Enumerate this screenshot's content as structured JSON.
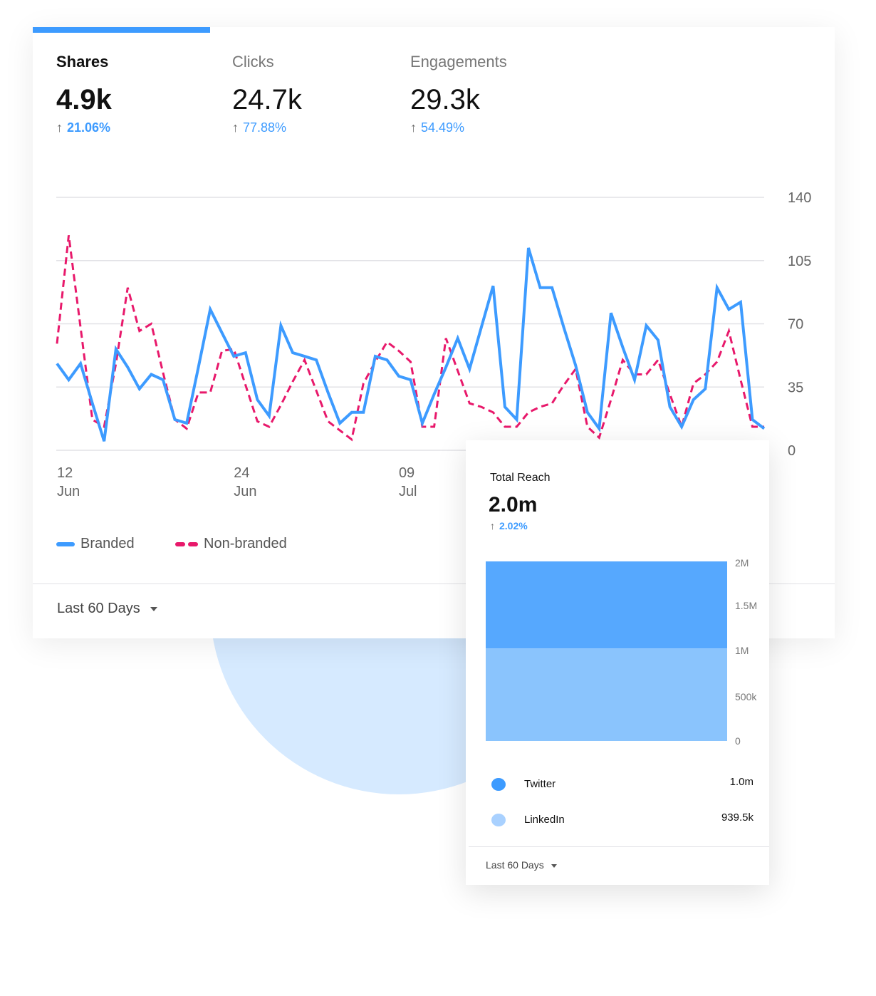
{
  "colors": {
    "accent": "#3d9bff",
    "branded": "#3d9bff",
    "non_branded": "#e8196b",
    "twitter": "#3d9bff",
    "linkedin": "#a9d1ff",
    "grid": "#e2e2e6",
    "background_circle": "#d6eaff"
  },
  "tabs": [
    {
      "label": "Shares",
      "value": "4.9k",
      "change": "21.06%",
      "active": true,
      "icon": "arrow-up-icon"
    },
    {
      "label": "Clicks",
      "value": "24.7k",
      "change": "77.88%",
      "active": false,
      "icon": "arrow-up-icon"
    },
    {
      "label": "Engagements",
      "value": "29.3k",
      "change": "54.49%",
      "active": false,
      "icon": "arrow-up-icon"
    }
  ],
  "arrow_glyph": "↑",
  "legend": {
    "branded": "Branded",
    "non_branded": "Non-branded"
  },
  "footer": {
    "range": "Last 60 Days"
  },
  "popup": {
    "title": "Total Reach",
    "value": "2.0m",
    "change": "2.02%",
    "items": [
      {
        "name": "Twitter",
        "value": "1.0m"
      },
      {
        "name": "LinkedIn",
        "value": "939.5k"
      }
    ],
    "footer": "Last 60 Days"
  },
  "chart_data": [
    {
      "type": "line",
      "ylim": [
        0,
        140
      ],
      "yticks": [
        "0",
        "35",
        "70",
        "105",
        "140"
      ],
      "ytick_values": [
        0,
        35,
        70,
        105,
        140
      ],
      "x_ticks": [
        {
          "index": 0,
          "day": "12",
          "month": "Jun"
        },
        {
          "index": 15,
          "day": "24",
          "month": "Jun"
        },
        {
          "index": 29,
          "day": "09",
          "month": "Jul"
        }
      ],
      "grid": true,
      "legend_position": "bottom-left",
      "series": [
        {
          "name": "Branded",
          "style": "solid",
          "values": [
            48,
            39,
            48,
            26,
            5,
            56,
            46,
            34,
            42,
            39,
            17,
            15,
            46,
            78,
            65,
            52,
            54,
            28,
            19,
            69,
            54,
            52,
            50,
            32,
            15,
            21,
            21,
            52,
            50,
            41,
            39,
            15,
            31,
            46,
            62,
            45,
            68,
            91,
            24,
            17,
            112,
            90,
            90,
            68,
            47,
            21,
            12,
            76,
            57,
            39,
            69,
            61,
            24,
            13,
            28,
            34,
            90,
            78,
            82,
            17,
            12
          ]
        },
        {
          "name": "Non-branded",
          "style": "dashed",
          "values": [
            59,
            119,
            68,
            17,
            13,
            48,
            90,
            66,
            70,
            43,
            17,
            12,
            32,
            32,
            55,
            56,
            36,
            16,
            13,
            25,
            38,
            50,
            33,
            16,
            11,
            6,
            37,
            49,
            60,
            55,
            49,
            13,
            13,
            62,
            44,
            26,
            24,
            21,
            13,
            13,
            21,
            24,
            26,
            36,
            45,
            13,
            7,
            28,
            50,
            42,
            42,
            50,
            31,
            13,
            37,
            42,
            49,
            66,
            39,
            13,
            13
          ]
        }
      ]
    },
    {
      "type": "area",
      "stacked": true,
      "ylim": [
        0,
        2000000
      ],
      "yticks": [
        "0",
        "500k",
        "1M",
        "1.5M",
        "2M"
      ],
      "ytick_values": [
        0,
        500000,
        1000000,
        1500000,
        2000000
      ],
      "series": [
        {
          "name": "LinkedIn",
          "values": [
            1030000,
            1030000
          ]
        },
        {
          "name": "Twitter",
          "values": [
            970000,
            970000
          ]
        }
      ]
    }
  ]
}
